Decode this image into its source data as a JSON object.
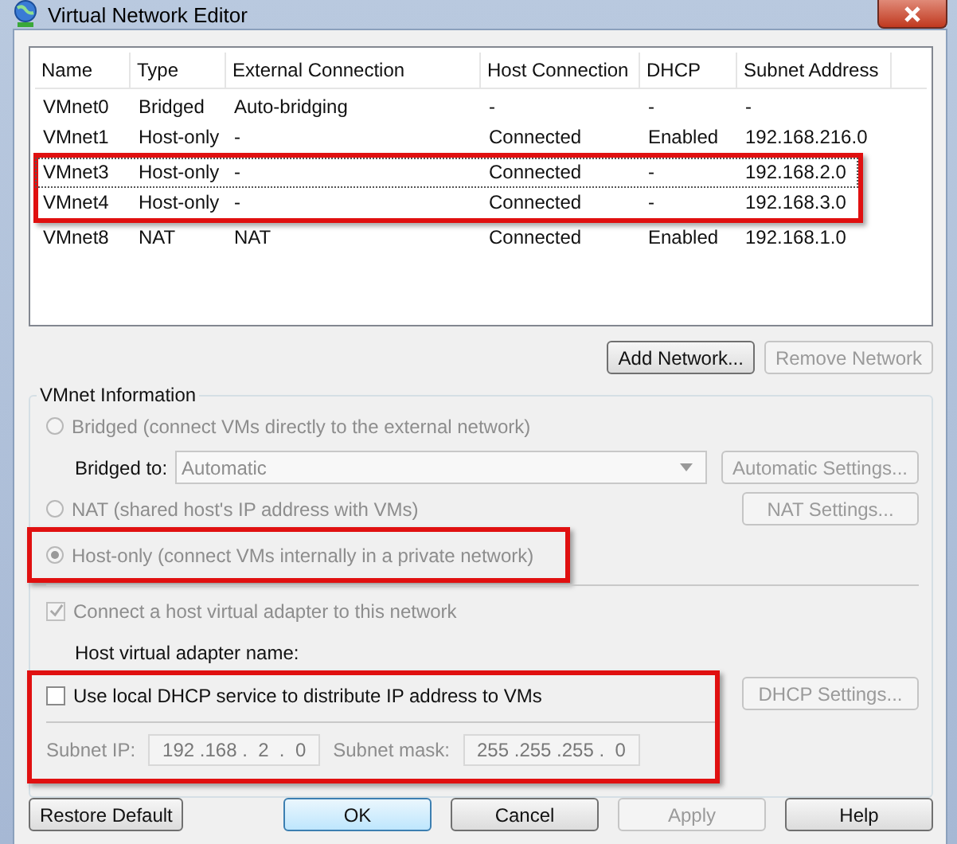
{
  "window": {
    "title": "Virtual Network Editor"
  },
  "table": {
    "columns": [
      "Name",
      "Type",
      "External Connection",
      "Host Connection",
      "DHCP",
      "Subnet Address"
    ],
    "rows": [
      {
        "cells": [
          "VMnet0",
          "Bridged",
          "Auto-bridging",
          "-",
          "-",
          "-"
        ],
        "selected": false,
        "highlighted": false
      },
      {
        "cells": [
          "VMnet1",
          "Host-only",
          "-",
          "Connected",
          "Enabled",
          "192.168.216.0"
        ],
        "selected": false,
        "highlighted": false
      },
      {
        "cells": [
          "VMnet3",
          "Host-only",
          "-",
          "Connected",
          "-",
          "192.168.2.0"
        ],
        "selected": true,
        "highlighted": true
      },
      {
        "cells": [
          "VMnet4",
          "Host-only",
          "-",
          "Connected",
          "-",
          "192.168.3.0"
        ],
        "selected": false,
        "highlighted": true
      },
      {
        "cells": [
          "VMnet8",
          "NAT",
          "NAT",
          "Connected",
          "Enabled",
          "192.168.1.0"
        ],
        "selected": false,
        "highlighted": false
      }
    ]
  },
  "table_buttons": [
    {
      "label": "Add Network...",
      "disabled": false
    },
    {
      "label": "Remove Network",
      "disabled": true
    }
  ],
  "vmnet_info": {
    "title": "VMnet Information",
    "bridged": {
      "label": "Bridged (connect VMs directly to the external network)",
      "selected": false,
      "disabled": true
    },
    "bridged_to": {
      "label": "Bridged to:",
      "value": "Automatic",
      "button": "Automatic Settings..."
    },
    "nat": {
      "label": "NAT (shared host's IP address with VMs)",
      "selected": false,
      "disabled": true,
      "button": "NAT Settings..."
    },
    "host_only": {
      "label": "Host-only (connect VMs internally in a private network)",
      "selected": true,
      "disabled": true,
      "highlighted": true
    },
    "connect_adapter": {
      "label": "Connect a host virtual adapter to this network",
      "checked": true,
      "disabled": true
    },
    "adapter_name_label": "Host virtual adapter name:",
    "dhcp": {
      "label": "Use local DHCP service to distribute IP address to VMs",
      "checked": false,
      "highlighted": true,
      "button": "DHCP Settings..."
    },
    "subnet_ip": {
      "label": "Subnet IP:",
      "value": "192 .168 .  2  .  0"
    },
    "subnet_mask": {
      "label": "Subnet mask:",
      "value": "255 .255 .255 .  0"
    }
  },
  "footer_buttons": [
    {
      "label": "Restore Default",
      "kind": "left",
      "disabled": false,
      "default": false
    },
    {
      "label": "OK",
      "kind": "right",
      "disabled": false,
      "default": true
    },
    {
      "label": "Cancel",
      "kind": "right",
      "disabled": false,
      "default": false
    },
    {
      "label": "Apply",
      "kind": "right",
      "disabled": true,
      "default": false
    },
    {
      "label": "Help",
      "kind": "right",
      "disabled": false,
      "default": false
    }
  ]
}
